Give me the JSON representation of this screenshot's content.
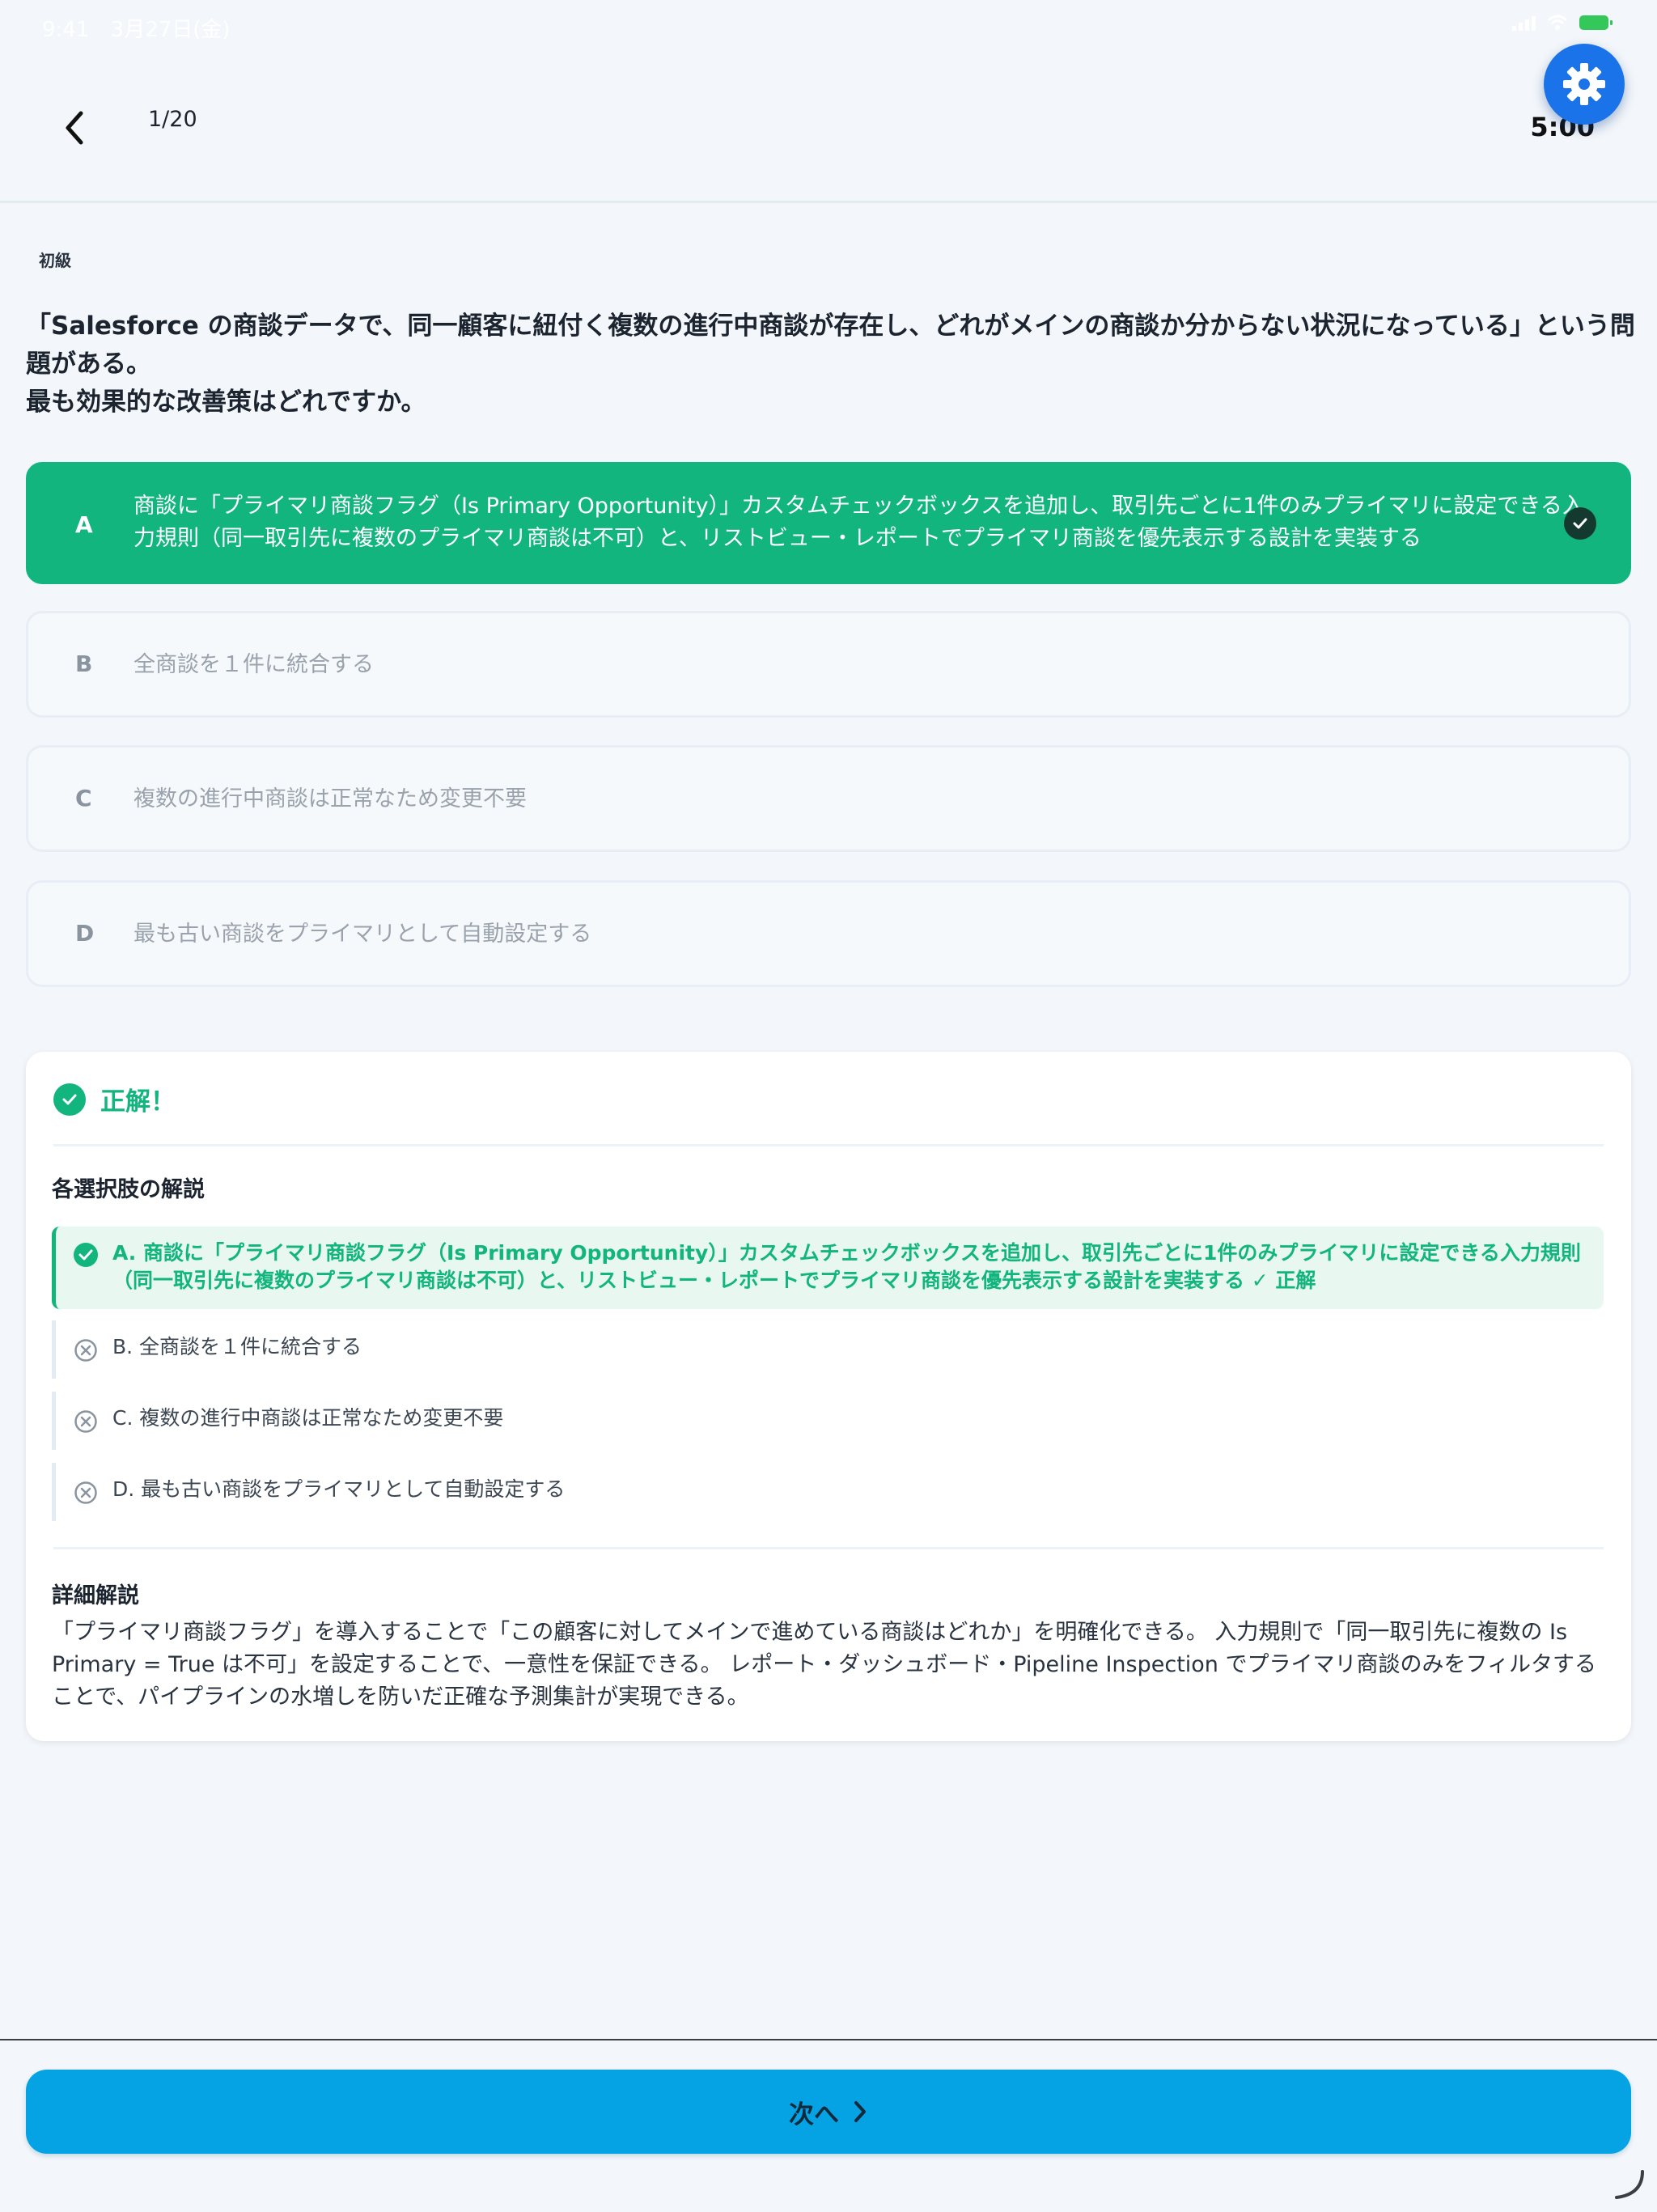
{
  "status": {
    "time": "9:41",
    "date": "3月27日(金)"
  },
  "header": {
    "progress": "1/20",
    "timer": "5:00"
  },
  "question": {
    "level": "初級",
    "line1": "「Salesforce の商談データで、同一顧客に紐付く複数の進行中商談が存在し、どれがメインの商談か分からない状況になっている」という問題がある。",
    "line2": "最も効果的な改善策はどれですか。"
  },
  "options": [
    {
      "letter": "A",
      "text": "商談に「プライマリ商談フラグ（Is Primary Opportunity）」カスタムチェックボックスを追加し、取引先ごとに1件のみプライマリに設定できる入力規則（同一取引先に複数のプライマリ商談は不可）と、リストビュー・レポートでプライマリ商談を優先表示する設計を実装する",
      "state": "correct"
    },
    {
      "letter": "B",
      "text": "全商談を１件に統合する",
      "state": "normal"
    },
    {
      "letter": "C",
      "text": "複数の進行中商談は正常なため変更不要",
      "state": "normal"
    },
    {
      "letter": "D",
      "text": "最も古い商談をプライマリとして自動設定する",
      "state": "normal"
    }
  ],
  "explanation": {
    "result": "正解！",
    "section_title": "各選択肢の解説",
    "items": [
      {
        "text": "A. 商談に「プライマリ商談フラグ（Is Primary Opportunity）」カスタムチェックボックスを追加し、取引先ごとに1件のみプライマリに設定できる入力規則（同一取引先に複数のプライマリ商談は不可）と、リストビュー・レポートでプライマリ商談を優先表示する設計を実装する ✓ 正解",
        "state": "correct"
      },
      {
        "text": "B. 全商談を１件に統合する",
        "state": "wrong"
      },
      {
        "text": "C. 複数の進行中商談は正常なため変更不要",
        "state": "wrong"
      },
      {
        "text": "D. 最も古い商談をプライマリとして自動設定する",
        "state": "wrong"
      }
    ],
    "detail_title": "詳細解説",
    "detail_text": "「プライマリ商談フラグ」を導入することで「この顧客に対してメインで進めている商談はどれか」を明確化できる。 入力規則で「同一取引先に複数の Is Primary = True は不可」を設定することで、一意性を保証できる。 レポート・ダッシュボード・Pipeline Inspection でプライマリ商談のみをフィルタすることで、パイプラインの水増しを防いだ正確な予測集計が実現できる。"
  },
  "footer": {
    "next_label": "次へ"
  },
  "colors": {
    "correct": "#12b57e",
    "primary_button": "#05a3e4",
    "gear_button": "#1a73e8"
  },
  "icons": [
    "chevron-left-icon",
    "gear-icon",
    "check-circle-icon",
    "x-circle-icon",
    "chevron-right-icon"
  ]
}
